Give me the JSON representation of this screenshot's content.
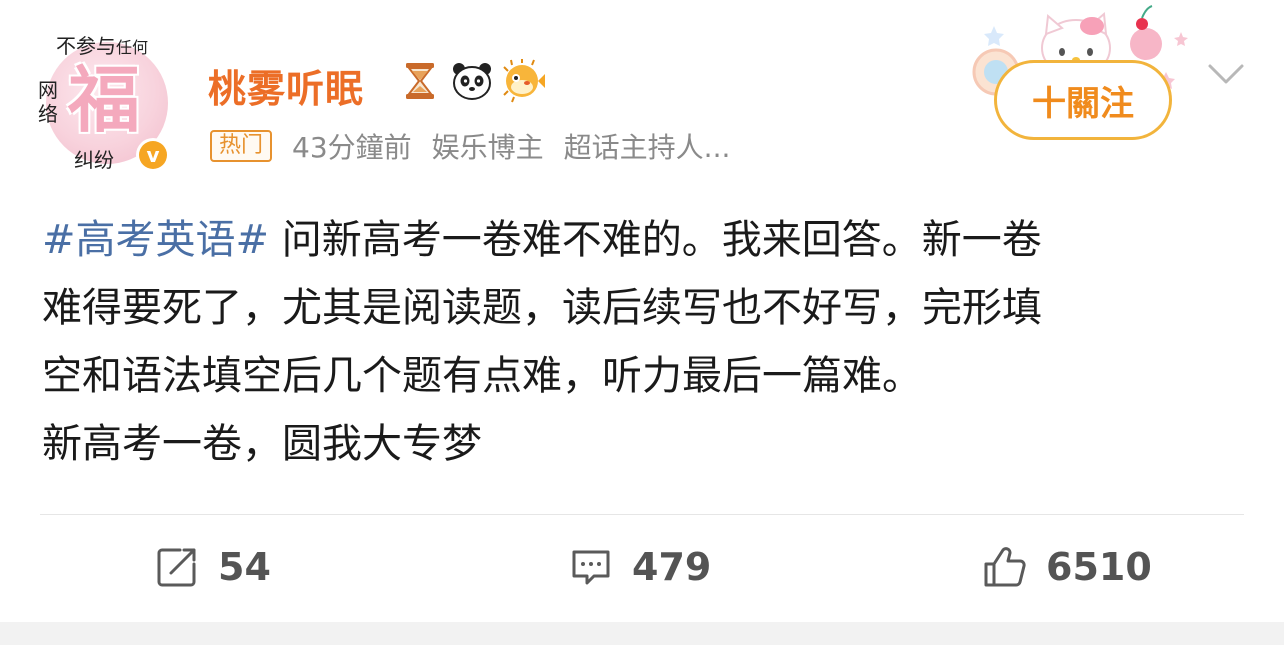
{
  "avatar": {
    "glyph": "福",
    "watermark_top_main": "不参与",
    "watermark_top_small": "任何",
    "watermark_left": "网络",
    "watermark_bottom": "纠纷",
    "verified_mark": "v"
  },
  "post": {
    "username": "桃雾听眠",
    "emojis": [
      "hourglass-icon",
      "panda-icon",
      "pufferfish-icon"
    ],
    "badge": "热门",
    "time": "43分鐘前",
    "role": "娱乐博主",
    "tag": "超话主持人...",
    "hashtag": "#高考英语#",
    "lines": [
      " 问新高考一卷难不难的。我来回答。新一卷",
      "难得要死了，尤其是阅读题，读后续写也不好写，完形填",
      "空和语法填空后几个题有点难，听力最后一篇难。",
      "新高考一卷，圆我大专梦"
    ]
  },
  "follow": {
    "label": "十關注"
  },
  "actions": {
    "repost_count": "54",
    "comment_count": "479",
    "like_count": "6510"
  },
  "colors": {
    "username": "#ec6e27",
    "hashtag": "#4a6fa5",
    "follow_border": "#f2b43c",
    "badge": "#e7922f"
  }
}
